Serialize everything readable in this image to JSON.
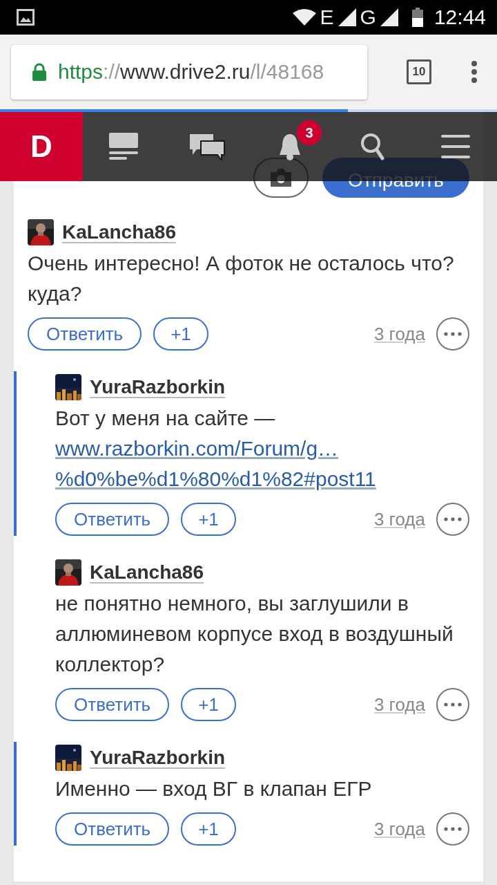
{
  "status_bar": {
    "network_1": "E",
    "network_2": "G",
    "time": "12:44"
  },
  "browser": {
    "url_scheme": "https",
    "url_separator": "://",
    "url_host": "www.drive2.ru",
    "url_path": "/l/48168",
    "tab_count": "10",
    "load": {
      "level": 0.7
    }
  },
  "site_nav": {
    "logo": "D",
    "notification_badge": "3"
  },
  "composer": {
    "send_button": "Отправить"
  },
  "comments": [
    {
      "author": "KaLancha86",
      "indented": false,
      "highlighted": false,
      "text": "Очень интересно! А фоток не осталось что? куда?",
      "reply_button": "Ответить",
      "plus_button": "+1",
      "age": "3 года"
    },
    {
      "author": "YuraRazborkin",
      "indented": true,
      "highlighted": true,
      "text": "Вот у меня на сайте —",
      "link_lines": [
        "www.razborkin.com/Forum/g…",
        "%d0%be%d1%80%d1%82#post11"
      ],
      "reply_button": "Ответить",
      "plus_button": "+1",
      "age": "3 года"
    },
    {
      "author": "KaLancha86",
      "indented": true,
      "highlighted": false,
      "text": "не понятно немного, вы заглушили в аллюминевом корпусе вход в воздушный коллектор?",
      "reply_button": "Ответить",
      "plus_button": "+1",
      "age": "3 года"
    },
    {
      "author": "YuraRazborkin",
      "indented": true,
      "highlighted": true,
      "text": "Именно — вход ВГ в клапан ЕГР",
      "reply_button": "Ответить",
      "plus_button": "+1",
      "age": "3 года"
    }
  ]
}
